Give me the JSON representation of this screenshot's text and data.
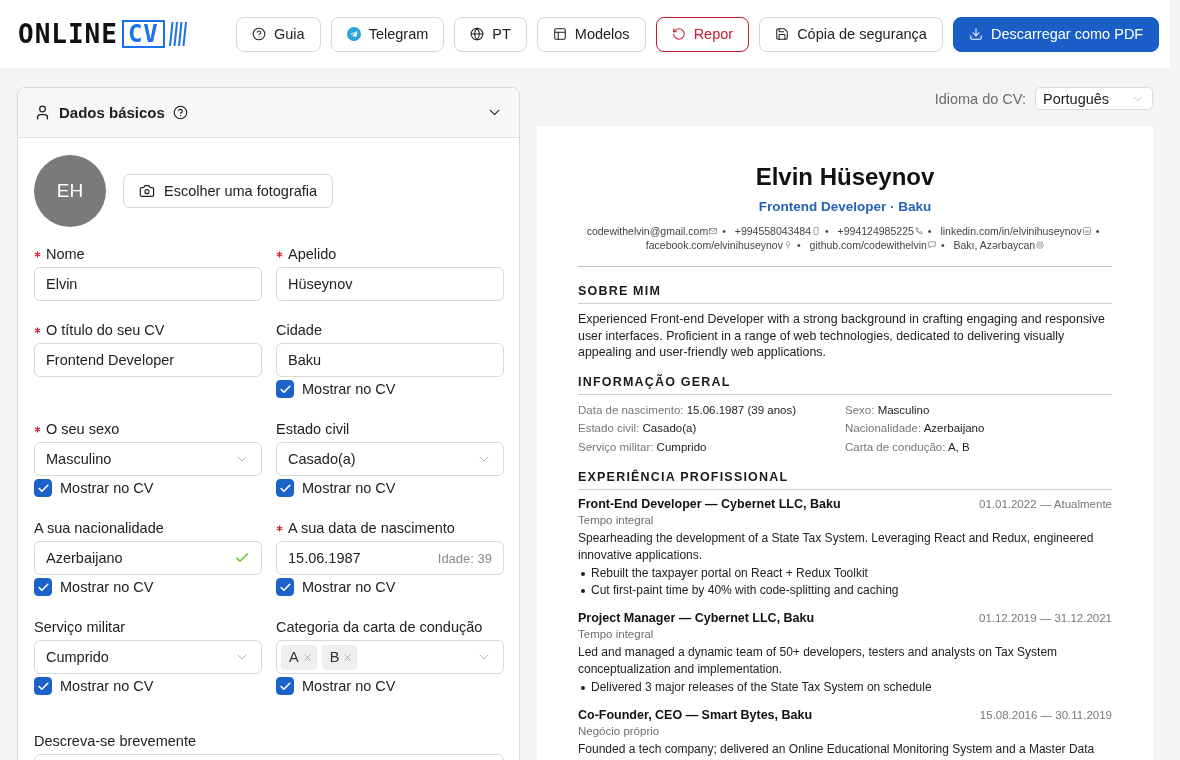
{
  "header": {
    "logo": {
      "wordmark": "ONLINE",
      "badge": "CV"
    },
    "buttons": [
      {
        "label": "Guia",
        "kind": "default"
      },
      {
        "label": "Telegram",
        "kind": "default"
      },
      {
        "label": "PT",
        "kind": "default"
      },
      {
        "label": "Modelos",
        "kind": "default"
      },
      {
        "label": "Repor",
        "kind": "danger"
      },
      {
        "label": "Cópia de segurança",
        "kind": "default"
      },
      {
        "label": "Descarregar como PDF",
        "kind": "primary"
      }
    ]
  },
  "form": {
    "title": "Dados básicos",
    "expanded": true,
    "avatar": {
      "initials": "EH"
    },
    "photo_button": "Escolher uma fotografia",
    "fields": [
      {
        "kind": "text",
        "label": "Nome",
        "required": true,
        "valid": false,
        "value": "Elvin"
      },
      {
        "kind": "text",
        "label": "Apelido",
        "required": true,
        "valid": false,
        "value": "Hüseynov"
      },
      {
        "kind": "text",
        "label": "O título do seu CV",
        "required": true,
        "valid": false,
        "value": "Frontend Developer"
      },
      {
        "kind": "text",
        "label": "Cidade",
        "required": false,
        "valid": false,
        "value": "Baku",
        "show_in_cv": {
          "label": "Mostrar no CV",
          "checked": true
        }
      },
      {
        "kind": "select",
        "label": "O seu sexo",
        "required": true,
        "valid": false,
        "value": "Masculino",
        "show_in_cv": {
          "label": "Mostrar no CV",
          "checked": true
        }
      },
      {
        "kind": "select",
        "label": "Estado civil",
        "required": false,
        "valid": false,
        "value": "Casado(a)",
        "show_in_cv": {
          "label": "Mostrar no CV",
          "checked": true
        }
      },
      {
        "kind": "text",
        "label": "A sua nacionalidade",
        "required": false,
        "valid": true,
        "value": "Azerbaijano",
        "show_in_cv": {
          "label": "Mostrar no CV",
          "checked": true
        }
      },
      {
        "kind": "date",
        "label": "A sua data de nascimento",
        "required": true,
        "valid": false,
        "value": "15.06.1987",
        "hint": "Idade: 39",
        "show_in_cv": {
          "label": "Mostrar no CV",
          "checked": true
        }
      },
      {
        "kind": "select",
        "label": "Serviço militar",
        "required": false,
        "valid": false,
        "value": "Cumprido",
        "show_in_cv": {
          "label": "Mostrar no CV",
          "checked": true
        }
      },
      {
        "kind": "tags",
        "label": "Categoria da carta de condução",
        "required": false,
        "valid": false,
        "tags": [
          "A",
          "B"
        ],
        "show_in_cv": {
          "label": "Mostrar no CV",
          "checked": true
        }
      },
      {
        "kind": "textarea",
        "label": "Descreva-se brevemente",
        "required": false,
        "valid": false
      }
    ]
  },
  "preview": {
    "language": {
      "label": "Idioma do CV:",
      "value": "Português"
    },
    "cv": {
      "name": "Elvin Hüseynov",
      "subtitle": "Frontend Developer · Baku",
      "contacts": [
        {
          "kind": "email",
          "text": "codewithelvin@gmail.com",
          "separator": "•"
        },
        {
          "kind": "mobile",
          "text": "+994558043484",
          "separator": "•"
        },
        {
          "kind": "phone",
          "text": "+994124985225",
          "separator": "•"
        },
        {
          "kind": "linkedin",
          "text": "linkedin.com/in/elvinihuseynov",
          "separator": "•"
        },
        {
          "kind": "facebook",
          "text": "facebook.com/elvinihuseynov",
          "separator": "•"
        },
        {
          "kind": "github",
          "text": "github.com/codewithelvin",
          "separator": "•"
        },
        {
          "kind": "location",
          "text": "Bakı, Azərbaycan"
        }
      ],
      "sections": [
        {
          "kind": "text",
          "title": "SOBRE MIM",
          "text": "Experienced Front-end Developer with a strong background in crafting engaging and responsive user interfaces. Proficient in a range of web technologies, dedicated to delivering visually appealing and user-friendly web applications."
        },
        {
          "kind": "info",
          "title": "INFORMAÇÃO GERAL",
          "items": [
            {
              "label": "Data de nascimento:",
              "value": "15.06.1987 (39 anos)"
            },
            {
              "label": "Sexo:",
              "value": "Masculino"
            },
            {
              "label": "Estado civil:",
              "value": "Casado(a)"
            },
            {
              "label": "Nacionalidade:",
              "value": "Azerbaijano"
            },
            {
              "label": "Serviço militar:",
              "value": "Cumprido"
            },
            {
              "label": "Carta de condução:",
              "value": "A, B"
            }
          ]
        },
        {
          "kind": "experience",
          "title": "EXPERIÊNCIA PROFISSIONAL",
          "jobs": [
            {
              "title": "Front-End Developer — Cybernet LLC, Baku",
              "dates": "01.01.2022 — Atualmente",
              "type": "Tempo integral",
              "description": "Spearheading the development of a State Tax System. Leveraging React and Redux, engineered innovative applications.",
              "bullets": [
                "Rebuilt the taxpayer portal on React + Redux Toolkit",
                "Cut first-paint time by 40% with code-splitting and caching"
              ]
            },
            {
              "title": "Project Manager — Cybernet LLC, Baku",
              "dates": "01.12.2019 — 31.12.2021",
              "type": "Tempo integral",
              "description": "Led and managed a dynamic team of 50+ developers, testers and analysts on Tax System conceptualization and implementation.",
              "bullets": [
                "Delivered 3 major releases of the State Tax System on schedule"
              ]
            },
            {
              "title": "Co-Founder, CEO — Smart Bytes, Baku",
              "dates": "15.08.2016 — 30.11.2019",
              "type": "Negócio próprio",
              "description": "Founded a tech company; delivered an Online Educational Monitoring System and a Master Data"
            }
          ]
        }
      ]
    }
  }
}
